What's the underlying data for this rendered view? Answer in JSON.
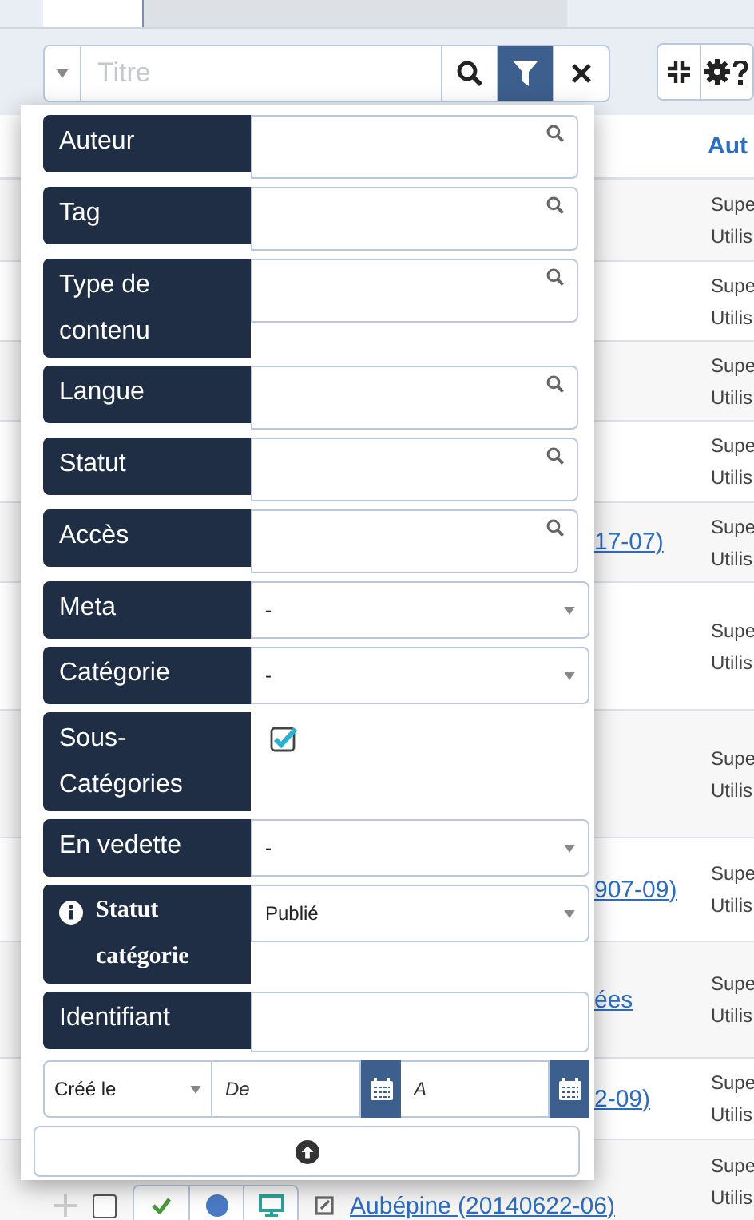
{
  "toolbar": {
    "search": {
      "placeholder": "Titre"
    },
    "filter_active": true
  },
  "table": {
    "header": "Aut",
    "rows": [
      {
        "link": "",
        "author": [
          "Supe",
          "Utilis"
        ]
      },
      {
        "link": "",
        "author": [
          "Supe",
          "Utilis"
        ]
      },
      {
        "link": "",
        "author": [
          "Supe",
          "Utilis"
        ]
      },
      {
        "link": "",
        "author": [
          "Supe",
          "Utilis"
        ]
      },
      {
        "link": "17-07)",
        "author": [
          "Supe",
          "Utilis"
        ]
      },
      {
        "link": "",
        "author": [
          "Supe",
          "Utilis"
        ]
      },
      {
        "link": "",
        "author": [
          "Supe",
          "Utilis"
        ]
      },
      {
        "link": "907-09)",
        "author": [
          "Supe",
          "Utilis"
        ]
      },
      {
        "link": "ées",
        "author": [
          "Supe",
          "Utilis"
        ]
      },
      {
        "link": "2-09)",
        "author": [
          "Supe",
          "Utilis"
        ]
      },
      {
        "link": "Aubépine (20140622-06)",
        "author": [
          "Supe",
          "Utilis"
        ],
        "checked": false
      }
    ]
  },
  "filters": [
    {
      "kind": "search",
      "label": "Auteur"
    },
    {
      "kind": "search",
      "label": "Tag"
    },
    {
      "kind": "search",
      "label": "Type de contenu"
    },
    {
      "kind": "search",
      "label": "Langue"
    },
    {
      "kind": "search",
      "label": "Statut"
    },
    {
      "kind": "search",
      "label": "Accès"
    },
    {
      "kind": "select",
      "label": "Meta",
      "value": "-"
    },
    {
      "kind": "select",
      "label": "Catégorie",
      "value": "-"
    },
    {
      "kind": "checkbox",
      "label": "Sous-Catégories",
      "checked": true
    },
    {
      "kind": "select",
      "label": "En vedette",
      "value": "-"
    },
    {
      "kind": "select",
      "label": "Statut catégorie",
      "value": "Publié",
      "info": true
    },
    {
      "kind": "text",
      "label": "Identifiant"
    }
  ],
  "date_filter": {
    "field": "Créé le",
    "from_placeholder": "De",
    "to_placeholder": "A"
  }
}
